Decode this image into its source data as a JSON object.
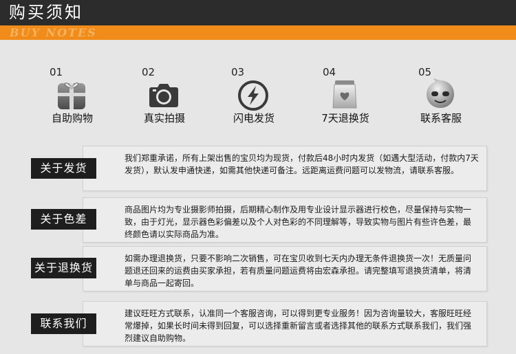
{
  "header": {
    "title": "购买须知",
    "subtitle": "BUY NOTES"
  },
  "features": [
    {
      "num": "01",
      "label": "自助购物",
      "icon": "gift-box-icon"
    },
    {
      "num": "02",
      "label": "真实拍摄",
      "icon": "camera-icon"
    },
    {
      "num": "03",
      "label": "闪电发货",
      "icon": "lightning-icon"
    },
    {
      "num": "04",
      "label": "7天退换货",
      "icon": "heart-bag-icon"
    },
    {
      "num": "05",
      "label": "联系客服",
      "icon": "chat-face-icon"
    }
  ],
  "sections": [
    {
      "label": "关于发货",
      "text": "我们郑重承诺，所有上架出售的宝贝均为现货，付款后48小时内发货（如遇大型活动，付款内7天发货），默认发申通快递，如需其他快递可备注。远距离运费问题可以发物流，请联系客服。"
    },
    {
      "label": "关于色差",
      "text": "商品图片均为专业摄影师拍摄，后期精心制作及用专业设计显示器进行校色，尽量保持与实物一致，由于灯光，显示器色彩偏差以及个人对色彩的不同理解等，导致实物与图片有些许色差，最终颜色请以实际商品为准。"
    },
    {
      "label": "关于退换货",
      "text": "如需办理退换货，只要不影响二次销售，可在宝贝收到七天内办理无条件退换货一次！无质量问题退还回来的运费由买家承担，若有质量问题运费将由宏森承担。请完整填写退换货清单，将清单与商品一起寄回。"
    },
    {
      "label": "联系我们",
      "text": "建议旺旺方式联系，认准同一个客服咨询，可以得到更专业服务！因为咨询量较大，客服旺旺经常爆掉，如果长时间未得到回复，可以选择重新留言或者选择其他的联系方式联系我们，我们强烈建议自助购物。"
    }
  ],
  "colors": {
    "header_bg": "#2c2c2c",
    "accent_orange": "#f18c1b",
    "label_bg": "#1e1e1e",
    "page_bg": "#e6e6e6"
  }
}
